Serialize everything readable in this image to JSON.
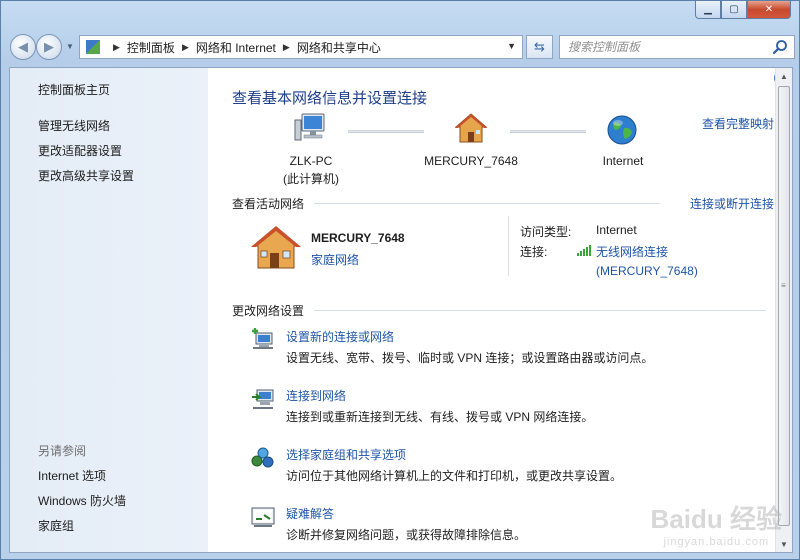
{
  "window": {
    "minimize_glyph": "▁",
    "maximize_glyph": "▢",
    "close_glyph": "✕"
  },
  "address_bar": {
    "breadcrumbs": [
      "控制面板",
      "网络和 Internet",
      "网络和共享中心"
    ],
    "search_placeholder": "搜索控制面板"
  },
  "sidebar": {
    "home": "控制面板主页",
    "links": [
      "管理无线网络",
      "更改适配器设置",
      "更改高级共享设置"
    ],
    "see_also_header": "另请参阅",
    "see_also": [
      "Internet 选项",
      "Windows 防火墙",
      "家庭组"
    ]
  },
  "main": {
    "title": "查看基本网络信息并设置连接",
    "full_map_link": "查看完整映射",
    "map": {
      "computer_name": "ZLK-PC",
      "computer_sub": "(此计算机)",
      "router_name": "MERCURY_7648",
      "internet": "Internet"
    },
    "active": {
      "label": "查看活动网络",
      "connect_link": "连接或断开连接",
      "network_name": "MERCURY_7648",
      "network_type": "家庭网络",
      "access_type_label": "访问类型:",
      "access_type_value": "Internet",
      "connection_label": "连接:",
      "connection_value_line1": "无线网络连接",
      "connection_value_line2": "(MERCURY_7648)"
    },
    "change": {
      "label": "更改网络设置",
      "tasks": [
        {
          "title": "设置新的连接或网络",
          "desc": "设置无线、宽带、拨号、临时或 VPN 连接；或设置路由器或访问点。"
        },
        {
          "title": "连接到网络",
          "desc": "连接到或重新连接到无线、有线、拨号或 VPN 网络连接。"
        },
        {
          "title": "选择家庭组和共享选项",
          "desc": "访问位于其他网络计算机上的文件和打印机，或更改共享设置。"
        },
        {
          "title": "疑难解答",
          "desc": "诊断并修复网络问题，或获得故障排除信息。"
        }
      ]
    }
  },
  "colors": {
    "link": "#1f55a8",
    "title": "#1e3f8a"
  },
  "watermark": {
    "text": "Baidu 经验",
    "sub": "jingyan.baidu.com"
  }
}
